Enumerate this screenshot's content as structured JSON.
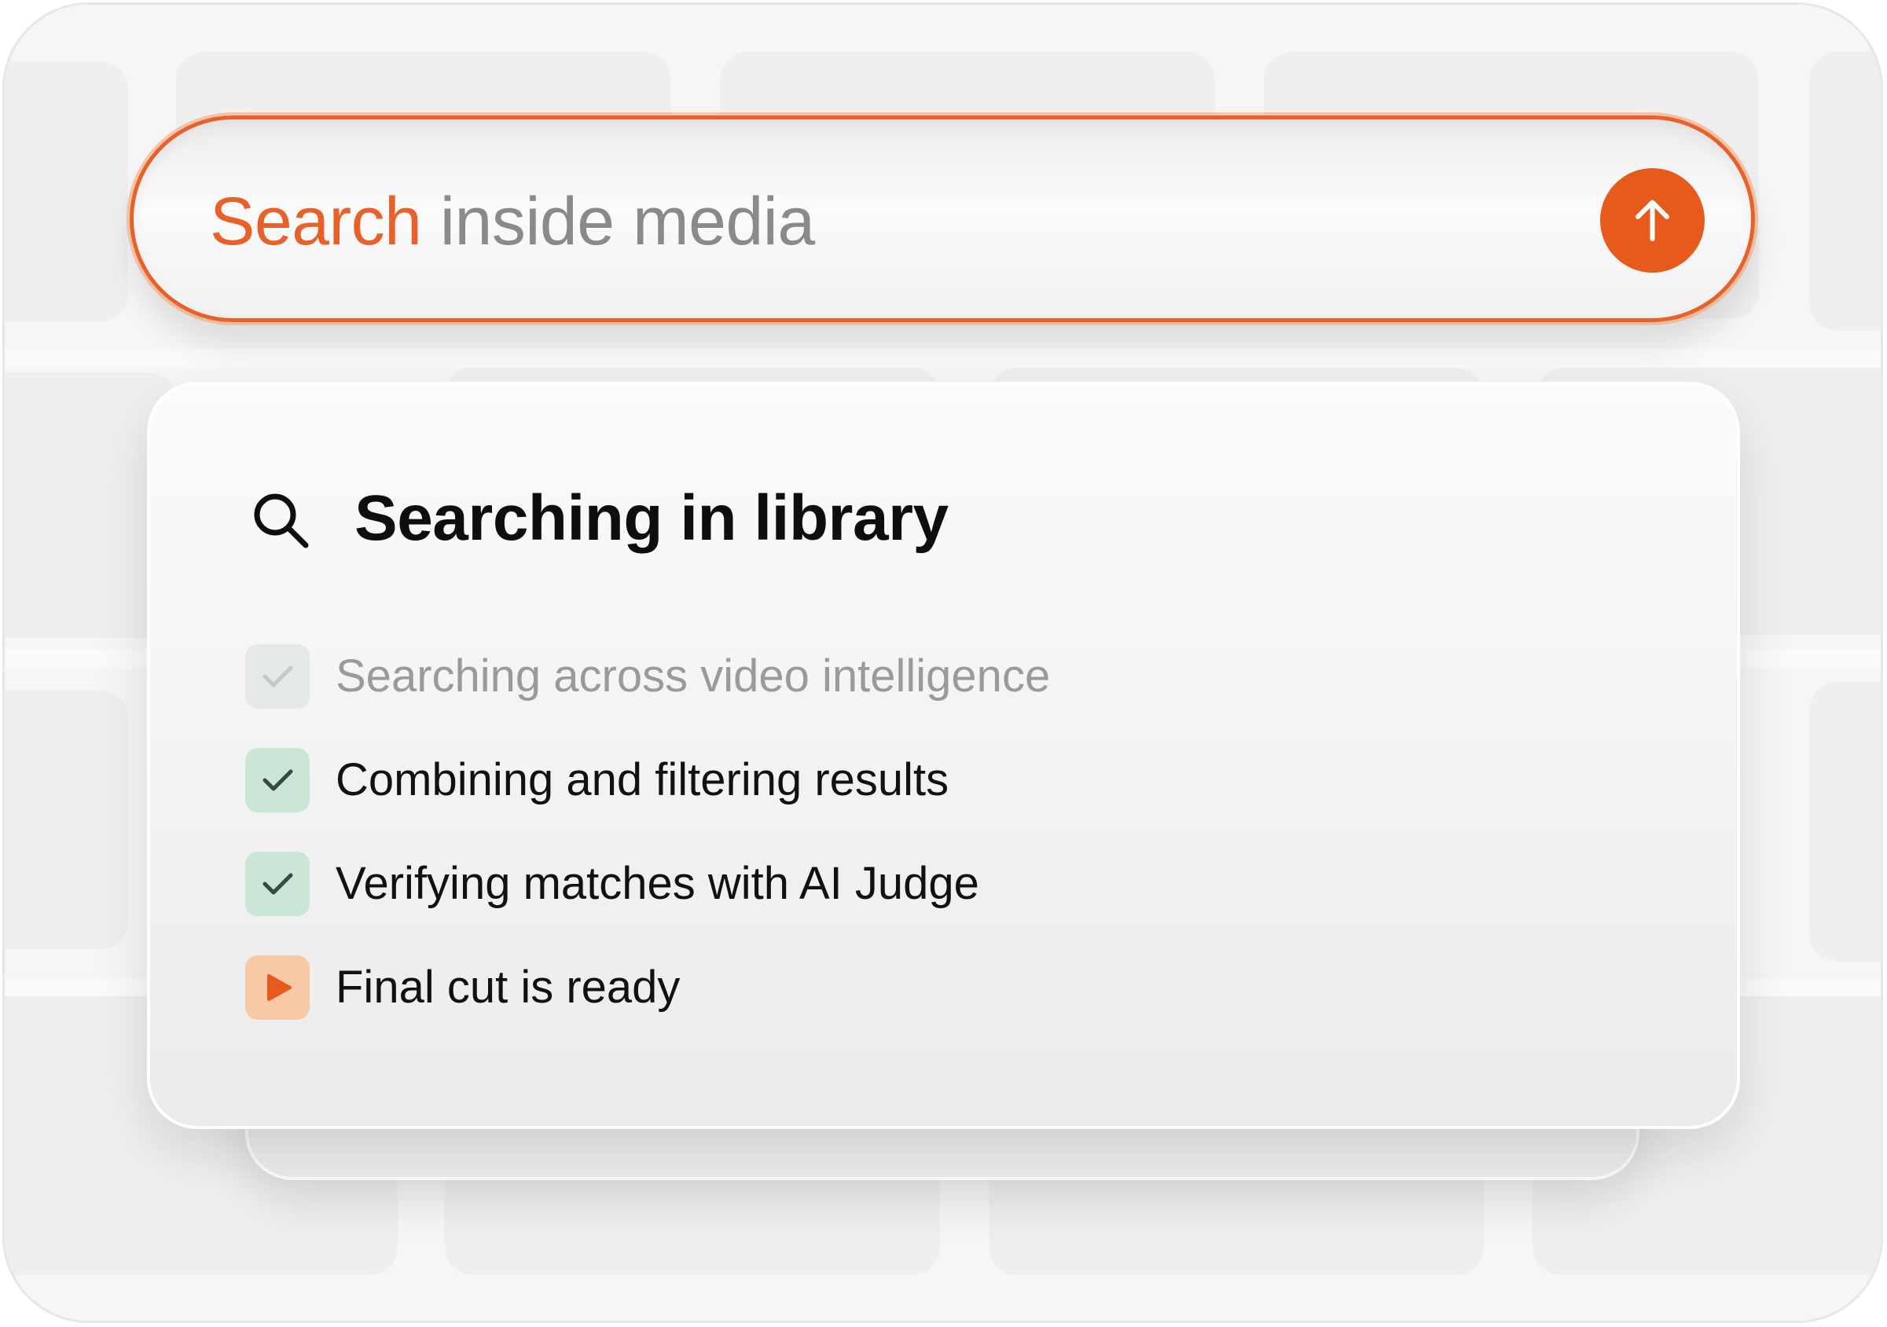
{
  "search": {
    "highlight": "Search",
    "rest": " inside media",
    "submit_icon": "arrow-up-icon",
    "accent_color": "#e8612a"
  },
  "panel": {
    "title": "Searching in library",
    "title_icon": "search-icon",
    "steps": [
      {
        "label": "Searching across video intelligence",
        "status": "faded",
        "icon": "check-icon"
      },
      {
        "label": "Combining and filtering results",
        "status": "done",
        "icon": "check-icon"
      },
      {
        "label": "Verifying matches with AI Judge",
        "status": "done",
        "icon": "check-icon"
      },
      {
        "label": "Final cut is ready",
        "status": "active",
        "icon": "play-icon"
      }
    ]
  }
}
